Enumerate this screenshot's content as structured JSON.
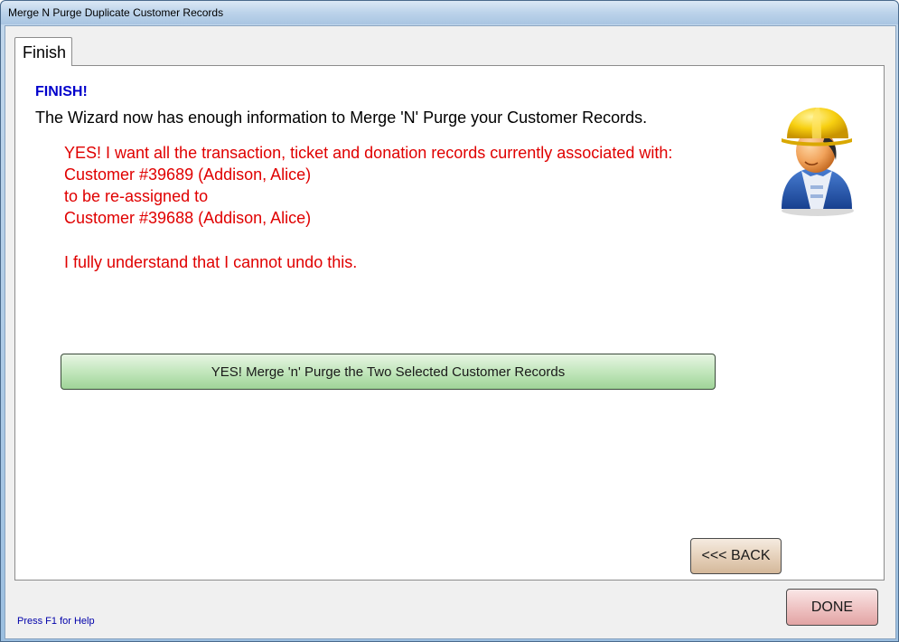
{
  "window": {
    "title": "Merge N Purge Duplicate Customer Records"
  },
  "tabs": [
    {
      "label": "Finish",
      "selected": true
    }
  ],
  "panel": {
    "heading": "FINISH!",
    "intro": "The Wizard now has enough information to Merge 'N' Purge your Customer Records.",
    "confirmation_lines": [
      "YES!  I want all the transaction, ticket and donation records currently associated with:",
      "Customer #39689 (Addison, Alice)",
      "to be re-assigned to",
      "Customer #39688 (Addison, Alice)",
      "I fully understand that I cannot undo this."
    ],
    "merge_button_label": "YES!  Merge 'n' Purge the Two Selected Customer Records",
    "back_button_label": "<<< BACK",
    "mascot_icon": "construction-worker-icon"
  },
  "footer": {
    "help_text": "Press F1 for Help",
    "done_button_label": "DONE"
  },
  "colors": {
    "heading": "#0000cc",
    "warning": "#e00000",
    "help": "#0000aa",
    "merge_button": "#b5dfae",
    "back_button": "#e2c8aa",
    "done_button": "#edbcbc"
  }
}
